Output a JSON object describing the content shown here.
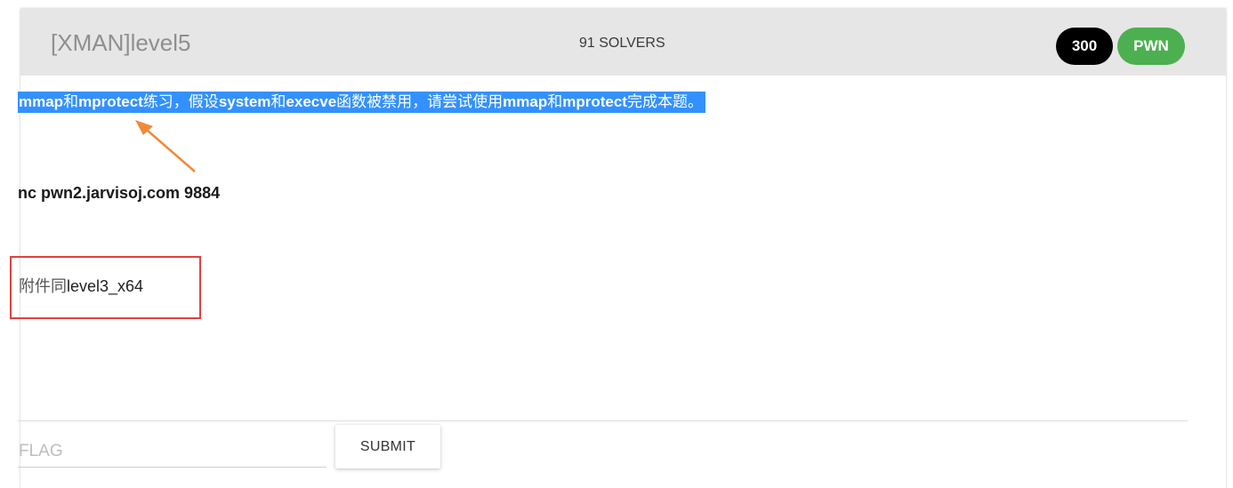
{
  "challenge": {
    "title": "[XMAN]level5",
    "solvers": "91 SOLVERS",
    "score": "300",
    "category": "PWN",
    "category_color": "#4caf50",
    "score_color": "#000000"
  },
  "description": {
    "parts": [
      "mmap",
      "和",
      "mprotect",
      "练习，假设",
      "system",
      "和",
      "execve",
      "函数被禁用，请尝试使用",
      "mmap",
      "和",
      "mprotect",
      "完成本题。"
    ],
    "highlight_color": "#3391ff",
    "server_line": "nc pwn2.jarvisoj.com 9884",
    "attachment_prefix": "附件同",
    "attachment_name": "level3_x64"
  },
  "submit_form": {
    "flag_placeholder": "FLAG",
    "flag_value": "",
    "submit_label": "SUBMIT"
  },
  "annotations": {
    "arrow_color": "#f08a3a",
    "box_color": "#e04040"
  }
}
